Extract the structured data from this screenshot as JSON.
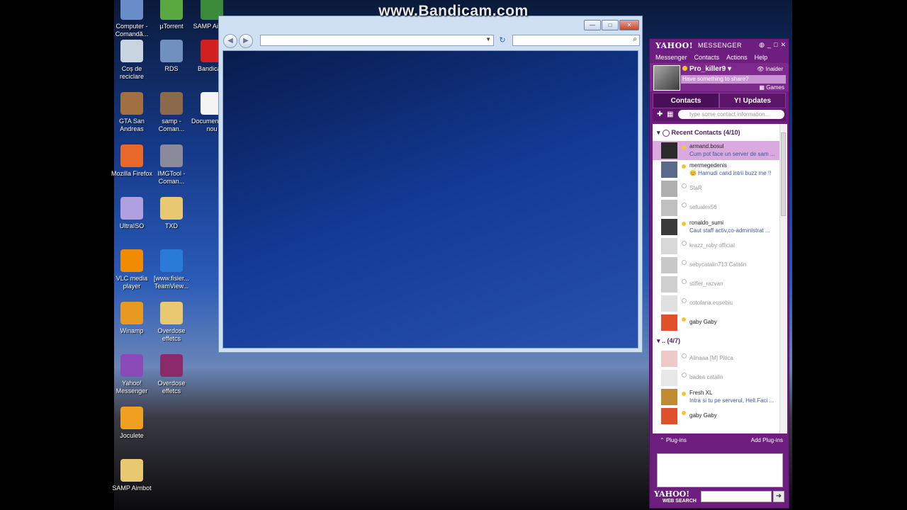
{
  "watermark": "www.Bandicam.com",
  "desktop_icons": [
    {
      "label": "Computer - Comandă...",
      "icon": "computer-icon",
      "color": "#6a8cc8"
    },
    {
      "label": "µTorrent",
      "icon": "utorrent-icon",
      "color": "#5aa840"
    },
    {
      "label": "SAMP Aimbo",
      "icon": "samp-icon",
      "color": "#3a8a3a"
    },
    {
      "label": "Coș de reciclare",
      "icon": "recycle-bin-icon",
      "color": "#c8d4e0"
    },
    {
      "label": "RDS",
      "icon": "network-icon",
      "color": "#7090c0"
    },
    {
      "label": "Bandicam",
      "icon": "bandicam-icon",
      "color": "#d02020"
    },
    {
      "label": "GTA San Andreas",
      "icon": "gta-icon",
      "color": "#a07040"
    },
    {
      "label": "samp - Coman...",
      "icon": "samp-shortcut-icon",
      "color": "#8a6a4a"
    },
    {
      "label": "Document text nou",
      "icon": "document-icon",
      "color": "#f4f4f4"
    },
    {
      "label": "Mozilla Firefox",
      "icon": "firefox-icon",
      "color": "#e8682a"
    },
    {
      "label": "IMGTool - Coman...",
      "icon": "imgtool-icon",
      "color": "#8a8a9a"
    },
    {
      "label": "UltraISO",
      "icon": "ultraiso-icon",
      "color": "#b0a0e0"
    },
    {
      "label": "TXD",
      "icon": "folder-icon",
      "color": "#e8c870"
    },
    {
      "label": "VLC media player",
      "icon": "vlc-icon",
      "color": "#f08a00"
    },
    {
      "label": "[www.fisier... TeamView...",
      "icon": "teamviewer-icon",
      "color": "#2a7ad8"
    },
    {
      "label": "Winamp",
      "icon": "winamp-icon",
      "color": "#e89a20"
    },
    {
      "label": "Overdose effetcs",
      "icon": "folder-icon",
      "color": "#e8c870"
    },
    {
      "label": "Yahoo! Messenger",
      "icon": "yahoo-messenger-icon",
      "color": "#8a4ab8"
    },
    {
      "label": "Overdose effetcs",
      "icon": "winrar-icon",
      "color": "#8a2a6a"
    },
    {
      "label": "Joculete",
      "icon": "joculete-icon",
      "color": "#f0a020"
    },
    {
      "label": "SAMP Aimbot",
      "icon": "folder-icon",
      "color": "#e8c870"
    }
  ],
  "browser": {
    "address_value": "",
    "search_value": "",
    "back_glyph": "◀",
    "forward_glyph": "▶",
    "refresh_glyph": "↻"
  },
  "messenger": {
    "brand": "YAHOO!",
    "product": "MESSENGER",
    "menu": [
      "Messenger",
      "Contacts",
      "Actions",
      "Help"
    ],
    "profile_name": "Pro_killer9",
    "profile_status": "Invisible",
    "profile_status_short": "Inaider",
    "share_placeholder": "Have something to share?",
    "games_label": "Games",
    "tabs": {
      "contacts": "Contacts",
      "updates": "Y! Updates"
    },
    "search_placeholder": "type some contact information...",
    "groups": [
      {
        "title": "Recent Contacts (4/10)",
        "contacts": [
          {
            "name": "armand.bosul",
            "status": "Cum pot face un server de sam ...",
            "online": true,
            "selected": true,
            "avatar_color": "#2a2a2a"
          },
          {
            "name": "mermegedenis",
            "status": "😊 Hamudi cand intrii buzz me !!",
            "online": true,
            "selected": false,
            "avatar_color": "#5a6a8a"
          },
          {
            "name": "StaR",
            "status": "",
            "online": false,
            "selected": false,
            "avatar_color": "#b0b0b0"
          },
          {
            "name": "sefualex56",
            "status": "",
            "online": false,
            "selected": false,
            "avatar_color": "#c0c0c0"
          },
          {
            "name": "ronaldo_sumi",
            "status": "Caut staff activ,co-administrat ...",
            "online": true,
            "selected": false,
            "avatar_color": "#3a3a3a"
          },
          {
            "name": "krazz_roby official",
            "status": "",
            "online": false,
            "selected": false,
            "avatar_color": "#d8d8d8"
          },
          {
            "name": "sebycatalin713 Catalin",
            "status": "",
            "online": false,
            "selected": false,
            "avatar_color": "#c8c8c8"
          },
          {
            "name": "stifler_razvan",
            "status": "",
            "online": false,
            "selected": false,
            "avatar_color": "#cfcfcf"
          },
          {
            "name": "cotofana.eusebiu",
            "status": "",
            "online": false,
            "selected": false,
            "avatar_color": "#e0e0e0"
          },
          {
            "name": "gaby Gaby",
            "status": "",
            "online": true,
            "selected": false,
            "avatar_color": "#e0502a"
          }
        ]
      },
      {
        "title": ".. (4/7)",
        "contacts": [
          {
            "name": "Alinaaa [M] Pitica",
            "status": "",
            "online": false,
            "selected": false,
            "avatar_color": "#f0c8c8"
          },
          {
            "name": "badea catalin",
            "status": "",
            "online": false,
            "selected": false,
            "avatar_color": "#e8e8e8"
          },
          {
            "name": "Fresh XL",
            "status": "Intra si tu pe serverul, Hell.Faci ...",
            "online": true,
            "selected": false,
            "avatar_color": "#c08a30"
          },
          {
            "name": "gaby Gaby",
            "status": "",
            "online": true,
            "selected": false,
            "avatar_color": "#e0502a"
          }
        ]
      }
    ],
    "plugins_label": "Plug-ins",
    "add_plugins_label": "Add Plug-ins",
    "search_brand": "YAHOO!",
    "search_sub": "WEB SEARCH",
    "search_value": ""
  }
}
